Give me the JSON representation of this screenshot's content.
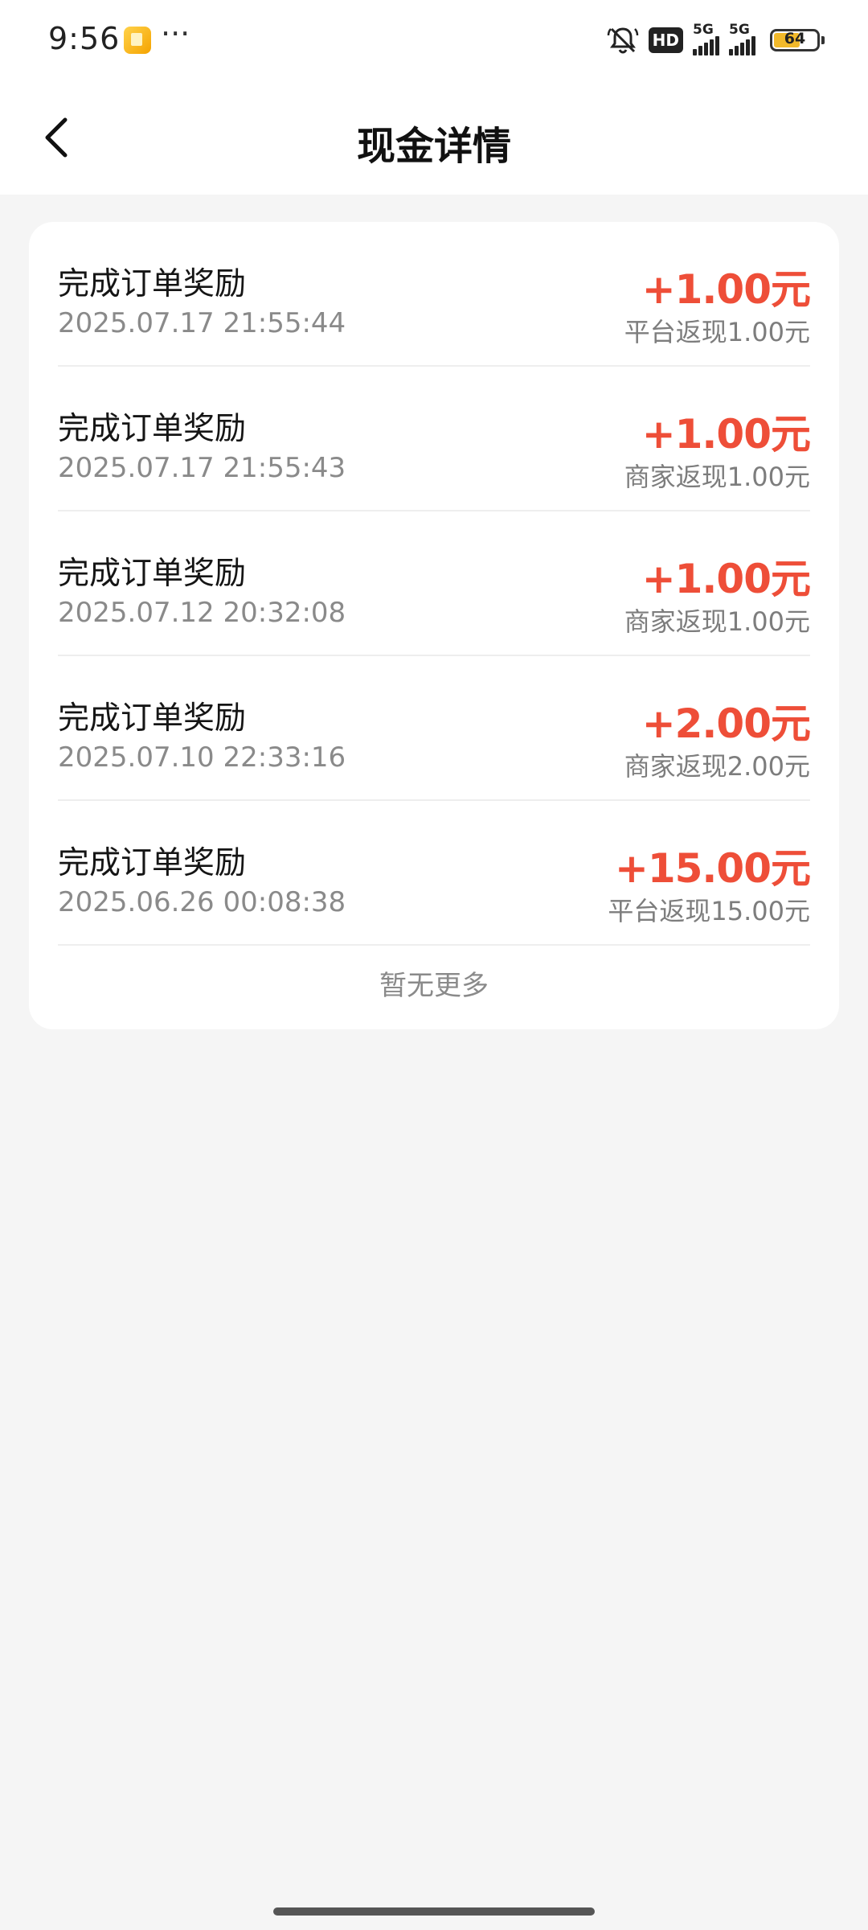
{
  "status_bar": {
    "time": "9:56",
    "more": "···",
    "hd_label": "HD",
    "network_1": "5G",
    "network_2": "5G",
    "battery": "64",
    "battery_level_percent": 64
  },
  "nav": {
    "title": "现金详情",
    "back_icon": "chevron-left-icon"
  },
  "records": [
    {
      "title": "完成订单奖励",
      "time": "2025.07.17 21:55:44",
      "amount": "+1.00元",
      "note": "平台返现1.00元"
    },
    {
      "title": "完成订单奖励",
      "time": "2025.07.17 21:55:43",
      "amount": "+1.00元",
      "note": "商家返现1.00元"
    },
    {
      "title": "完成订单奖励",
      "time": "2025.07.12 20:32:08",
      "amount": "+1.00元",
      "note": "商家返现1.00元"
    },
    {
      "title": "完成订单奖励",
      "time": "2025.07.10 22:33:16",
      "amount": "+2.00元",
      "note": "商家返现2.00元"
    },
    {
      "title": "完成订单奖励",
      "time": "2025.06.26 00:08:38",
      "amount": "+15.00元",
      "note": "平台返现15.00元"
    }
  ],
  "footer": {
    "no_more": "暂无更多"
  },
  "colors": {
    "amount": "#ee4e38",
    "background": "#f5f5f5",
    "card": "#ffffff"
  }
}
